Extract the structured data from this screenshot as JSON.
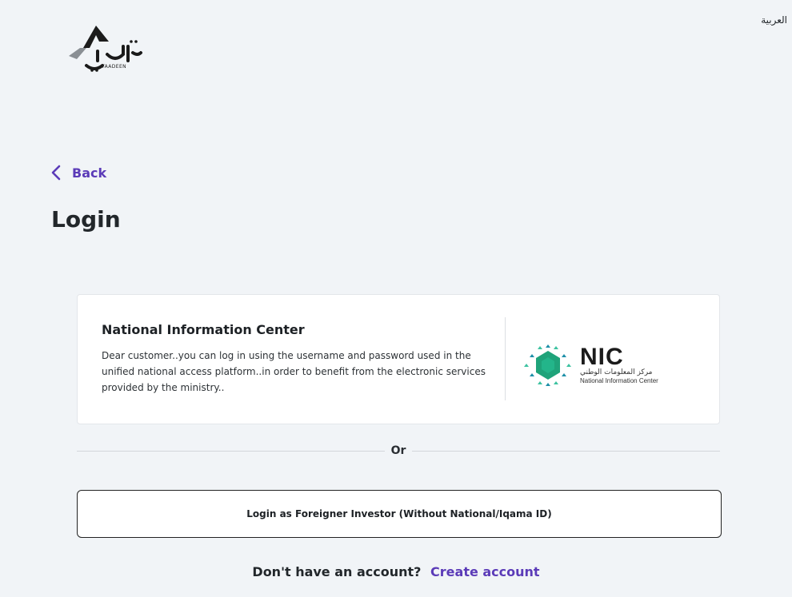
{
  "header": {
    "language_toggle": "العربية",
    "logo_ar": "تعدين",
    "logo_en": "TAADEEN"
  },
  "nav": {
    "back_label": "Back"
  },
  "page": {
    "title": "Login"
  },
  "nic_card": {
    "title": "National Information Center",
    "description": "Dear customer..you can log in using the username and password used in the unified national access platform..in order to benefit from the electronic services provided by the ministry..",
    "logo_abbr": "NIC",
    "logo_ar": "مركز المعلومات الوطني",
    "logo_en": "National Information Center"
  },
  "divider": {
    "or_label": "Or"
  },
  "foreign_login": {
    "label": "Login as Foreigner Investor (Without National/Iqama ID)"
  },
  "signup": {
    "question": "Don't have an account?",
    "link_label": "Create account"
  },
  "colors": {
    "background": "#f1f4f7",
    "accent": "#5b3bb8",
    "card": "#ffffff",
    "nic_green": "#1fa37a",
    "nic_teal": "#1d8fa8"
  }
}
